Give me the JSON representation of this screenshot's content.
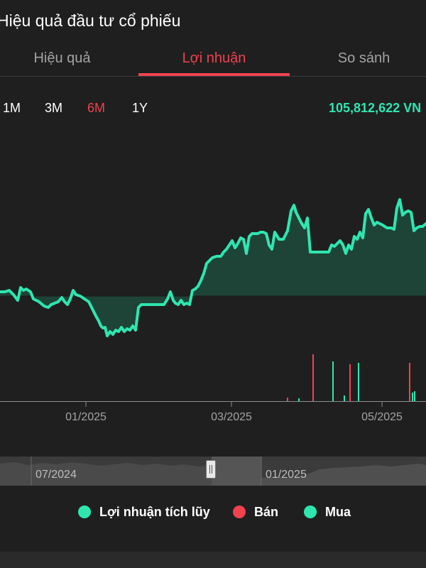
{
  "header": {
    "title": "Hiệu quả đầu tư cổ phiếu"
  },
  "tabs": [
    {
      "label": "Hiệu quả",
      "active": false
    },
    {
      "label": "Lợi nhuận",
      "active": true
    },
    {
      "label": "So sánh",
      "active": false
    }
  ],
  "ranges": [
    {
      "label": "1M",
      "active": false
    },
    {
      "label": "3M",
      "active": false
    },
    {
      "label": "6M",
      "active": true
    },
    {
      "label": "1Y",
      "active": false
    }
  ],
  "current_value": "105,812,622 VN",
  "colors": {
    "profit_line": "#2ee6b0",
    "sell": "#f0424f",
    "buy": "#2ee6b0",
    "active_tab": "#f0424f"
  },
  "x_ticks": [
    "01/2025",
    "03/2025",
    "05/2025"
  ],
  "navigator": {
    "labels": [
      "07/2024",
      "01/2025"
    ]
  },
  "legend": [
    {
      "label": "Lợi nhuận tích lũy",
      "color": "#2ee6b0"
    },
    {
      "label": "Bán",
      "color": "#f0424f"
    },
    {
      "label": "Mua",
      "color": "#2ee6b0"
    }
  ],
  "chart_data": {
    "type": "line",
    "grid": false,
    "baseline": 0,
    "profit_series": {
      "name": "Lợi nhuận tích lũy",
      "x": [
        0,
        7,
        13,
        19,
        25,
        29,
        33,
        37,
        43,
        47,
        55,
        62,
        68,
        72,
        77,
        82,
        87,
        91,
        95,
        99,
        103,
        107,
        113,
        119,
        125,
        130,
        135,
        139,
        142,
        145,
        148,
        151,
        155,
        159,
        163,
        167,
        171,
        175,
        179,
        183,
        187,
        191,
        195,
        199,
        203,
        207,
        213,
        219,
        225,
        231,
        236,
        240,
        244,
        247,
        251,
        255,
        259,
        263,
        267,
        271,
        275,
        279,
        283,
        287,
        291,
        295,
        299,
        305,
        311,
        315,
        319,
        323,
        327,
        331,
        335,
        339,
        343,
        347,
        351,
        355,
        359,
        363,
        367,
        371,
        375,
        379,
        383,
        387,
        393,
        399,
        405,
        410,
        414,
        417,
        421,
        425,
        429,
        433,
        437,
        441,
        447,
        455,
        463,
        467,
        471,
        475,
        479,
        483,
        487,
        491,
        495,
        499,
        503,
        507,
        511,
        515,
        519,
        523,
        527,
        531,
        535,
        539,
        545,
        551,
        555,
        559,
        563,
        567,
        571,
        575,
        579,
        583,
        587,
        591,
        595,
        600
      ],
      "y": [
        6,
        6,
        8,
        2,
        -6,
        12,
        8,
        10,
        6,
        -4,
        -8,
        -14,
        -16,
        -12,
        -10,
        -8,
        -2,
        -8,
        -12,
        -4,
        8,
        2,
        0,
        -4,
        -8,
        -18,
        -28,
        -35,
        -42,
        -45,
        -44,
        -56,
        -50,
        -54,
        -48,
        -50,
        -44,
        -50,
        -46,
        -48,
        -42,
        -48,
        -16,
        -12,
        -12,
        -12,
        -12,
        -12,
        -12,
        -12,
        -4,
        6,
        -6,
        -10,
        -12,
        -6,
        -12,
        -10,
        -12,
        8,
        10,
        14,
        22,
        32,
        46,
        50,
        54,
        56,
        56,
        62,
        66,
        72,
        78,
        68,
        74,
        82,
        80,
        60,
        84,
        88,
        88,
        88,
        90,
        90,
        88,
        72,
        66,
        90,
        80,
        80,
        92,
        120,
        128,
        118,
        110,
        102,
        96,
        110,
        62,
        62,
        62,
        62,
        62,
        72,
        70,
        74,
        78,
        72,
        60,
        72,
        66,
        84,
        80,
        90,
        82,
        116,
        122,
        110,
        100,
        104,
        102,
        100,
        96,
        96,
        94,
        124,
        136,
        114,
        118,
        120,
        118,
        92,
        96,
        98,
        98,
        102
      ]
    },
    "sell_volumes": {
      "name": "Bán",
      "x": [
        405,
        441,
        493,
        577
      ],
      "values": [
        5,
        66,
        52,
        54
      ]
    },
    "buy_volumes": {
      "name": "Mua",
      "x": [
        421,
        469,
        485,
        505,
        581,
        584
      ],
      "values": [
        4,
        56,
        8,
        54,
        12,
        14
      ]
    }
  }
}
